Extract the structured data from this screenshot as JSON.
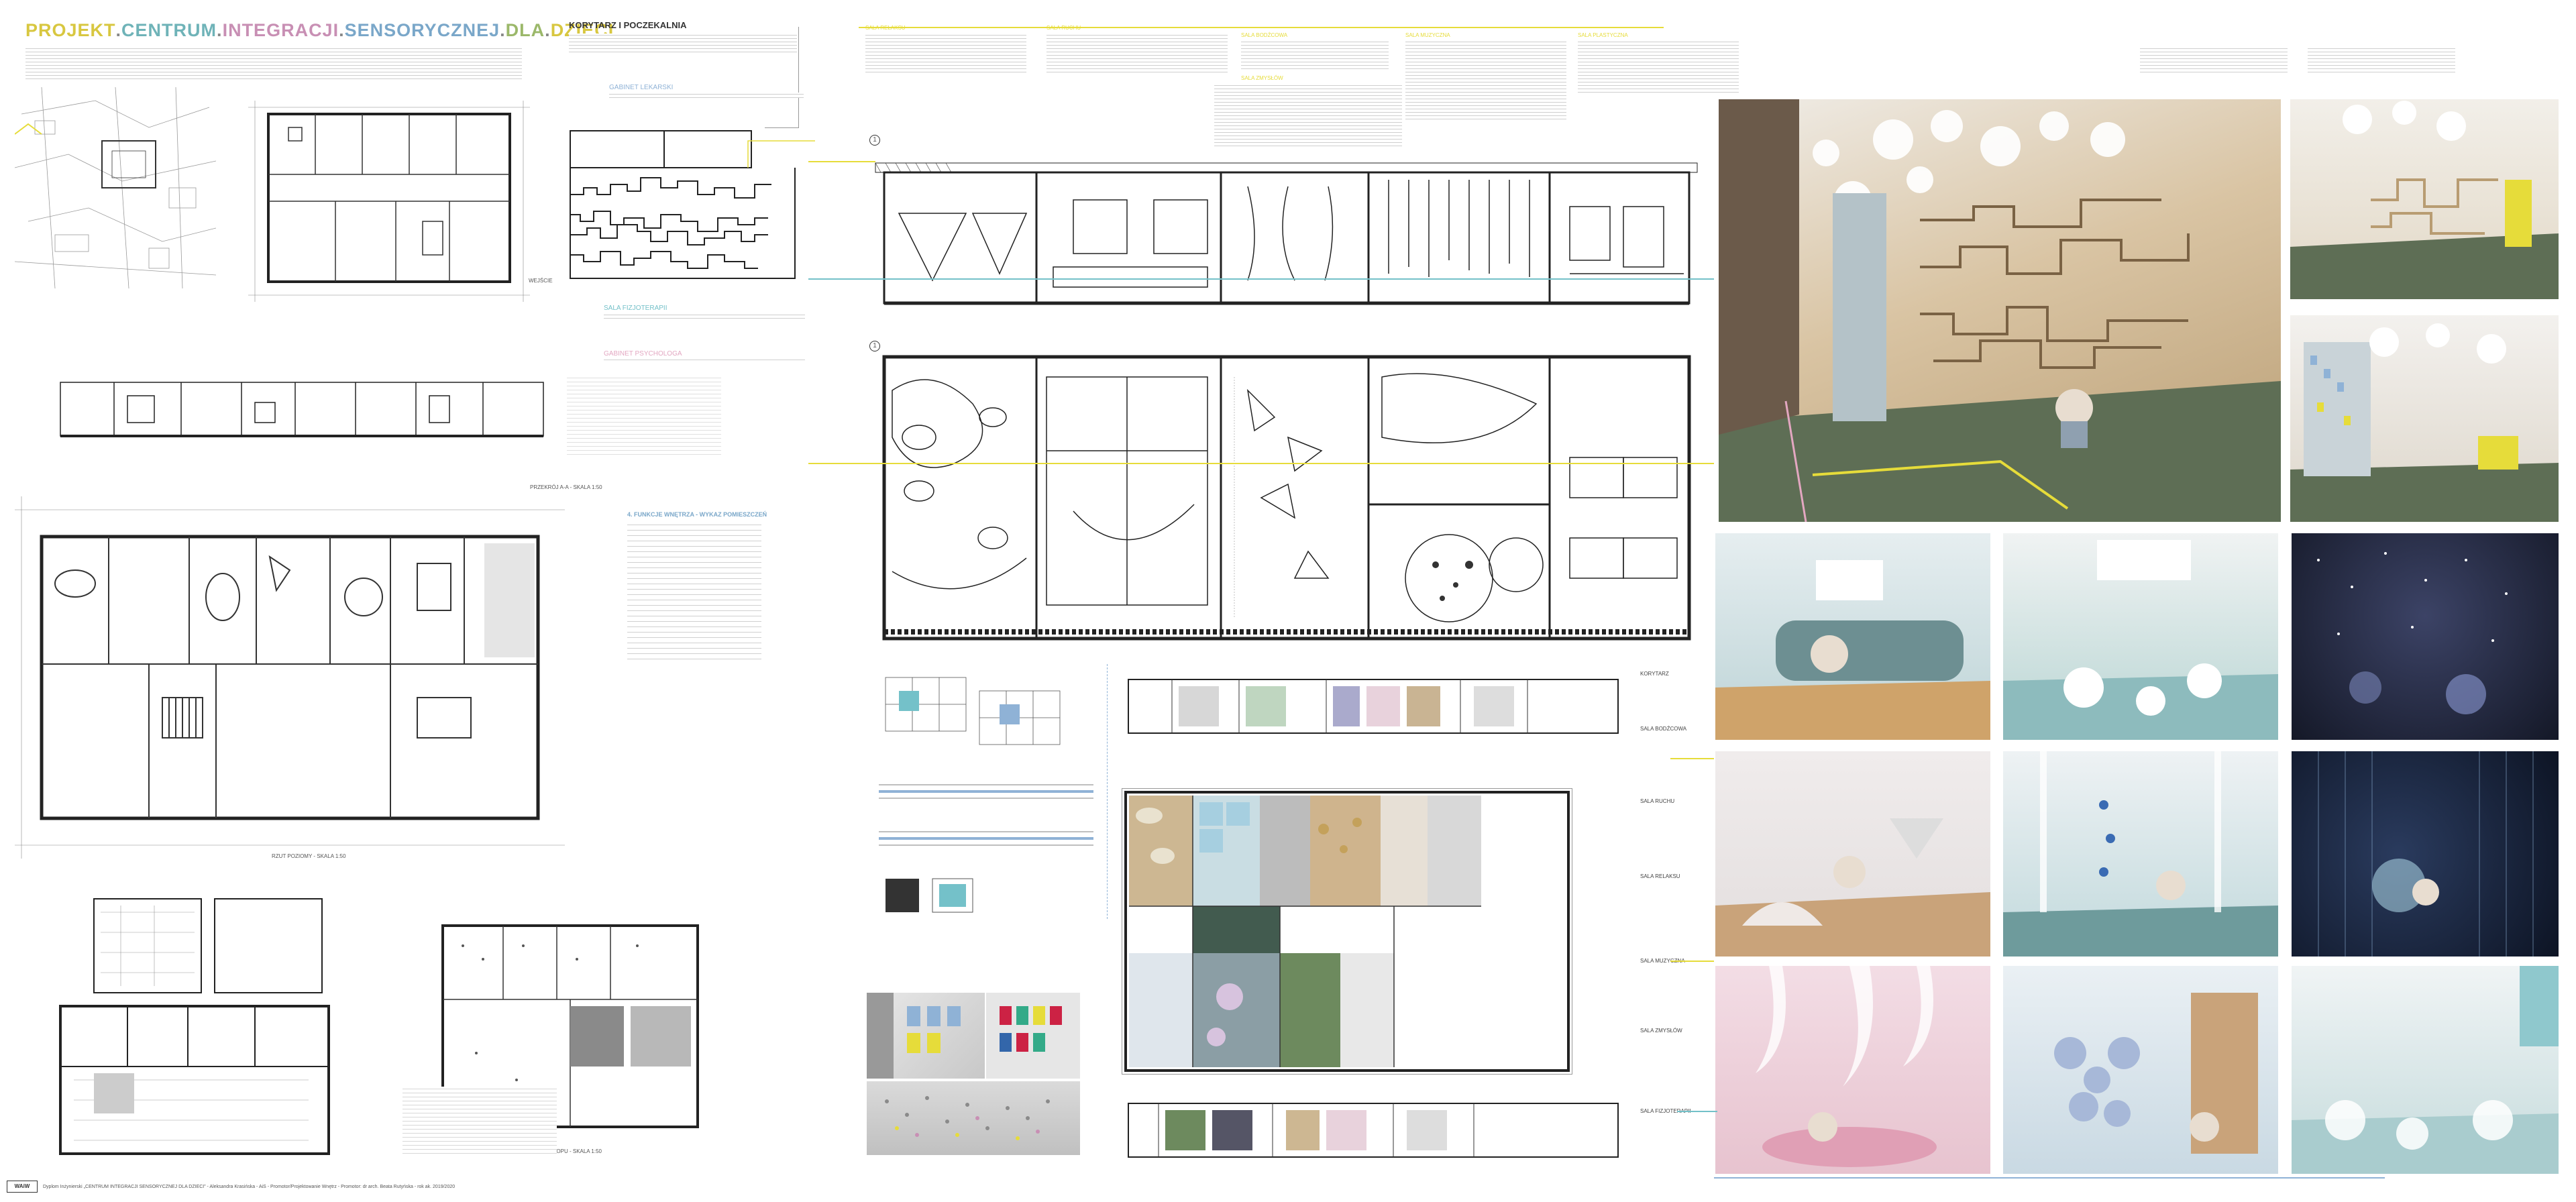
{
  "title": {
    "parts": [
      {
        "text": "PROJEKT",
        "color": "#d8c740"
      },
      {
        "text": ".",
        "color": "#888888"
      },
      {
        "text": "CENTRUM",
        "color": "#6fb3b8"
      },
      {
        "text": ".",
        "color": "#888888"
      },
      {
        "text": "INTEGRACJI",
        "color": "#c88fb4"
      },
      {
        "text": ".",
        "color": "#888888"
      },
      {
        "text": "SENSORYCZNEJ",
        "color": "#7aa7c9"
      },
      {
        "text": ".",
        "color": "#888888"
      },
      {
        "text": "DLA",
        "color": "#9bb86a"
      },
      {
        "text": ".",
        "color": "#888888"
      },
      {
        "text": "DZIECI",
        "color": "#d8c740"
      }
    ]
  },
  "corridor": {
    "title": "KORYTARZ I POCZEKALNIA"
  },
  "labels": {
    "gabinet_lekarski": "GABINET LEKARSKI",
    "sala_fizjoterapii": "SALA FIZJOTERAPII",
    "gabinet_psychologa": "GABINET PSYCHOLOGA",
    "funkcje": "4. FUNKCJE WNĘTRZA - WYKAZ POMIESZCZEŃ",
    "przekroj_aa": "PRZEKRÓJ A-A - SKALA 1:50",
    "rzut_poziomy": "RZUT POZIOMY - SKALA 1:50",
    "rzut_stropu": "RZUT STROPU - SKALA 1:50",
    "wejscie": "WEJŚCIE"
  },
  "room_headers": {
    "sala_relaksu": "SALA RELAKSU",
    "sala_ruchu": "SALA RUCHU",
    "sala_bodzcowa": "SALA BODŹCOWA",
    "sala_zmyslow": "SALA ZMYSŁÓW",
    "sala_muzyczna": "SALA MUZYCZNA",
    "sala_plastyczna": "SALA PLASTYCZNA"
  },
  "side_labels": {
    "korytarz": "KORYTARZ",
    "sala_bodzcowa": "SALA BODŹCOWA",
    "sala_ruchu": "SALA RUCHU",
    "sala_relaksu": "SALA RELAKSU",
    "sala_muzyczna": "SALA MUZYCZNA",
    "sala_zmyslow": "SALA ZMYSŁÓW",
    "sala_fizjoterapii": "SALA FIZJOTERAPII"
  },
  "section_markers": {
    "a": "1",
    "b": "1"
  },
  "footer": {
    "logo": "WAiW",
    "text": "Dyplom Inżynierski „CENTRUM INTEGRACJI SENSORYCZNEJ DLA DZIECI” - Aleksandra Krasińska - AiS - Promotor/Projektowanie Wnętrz - Promotor: dr arch. Beata Rutyńska - rok ak. 2019/2020"
  },
  "colors": {
    "yellow": "#e6dc3a",
    "teal": "#74c1c9",
    "pink": "#e3a7c1",
    "blue": "#8fb2d6"
  }
}
